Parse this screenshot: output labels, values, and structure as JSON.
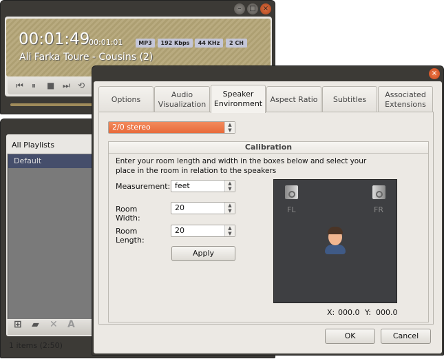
{
  "player": {
    "elapsed": "00:01:49",
    "remaining": "00:01:01",
    "badges": [
      "MP3",
      "192 Kbps",
      "44 KHz",
      "2 CH"
    ],
    "track": "Ali Farka Toure - Cousins (2)",
    "progress": 0.62
  },
  "playlist": {
    "header": "All Playlists",
    "items": [
      {
        "label": "Default",
        "selected": true
      }
    ],
    "status": "1 items (2:50)"
  },
  "dialog": {
    "tabs": [
      {
        "label": "Options"
      },
      {
        "label": "Audio Visualization"
      },
      {
        "label": "Speaker Environment",
        "active": true
      },
      {
        "label": "Aspect Ratio"
      },
      {
        "label": "Subtitles"
      },
      {
        "label": "Associated Extensions"
      }
    ],
    "speaker_mode": "2/0 stereo",
    "calibration": {
      "title": "Calibration",
      "instructions": "Enter your room length and width in the boxes below and select your place in the room in relation to the speakers",
      "measurement_label": "Measurement:",
      "measurement": "feet",
      "width_label": "Room Width:",
      "width": "20",
      "length_label": "Room Length:",
      "length": "20",
      "apply": "Apply",
      "speakers": [
        "FL",
        "FR"
      ],
      "x_label": "X:",
      "x": "000.0",
      "y_label": "Y:",
      "y": "000.0"
    },
    "ok": "OK",
    "cancel": "Cancel"
  },
  "colors": {
    "accent": "#ee7040",
    "selection": "#454e6b",
    "room": "#3e3f42"
  }
}
